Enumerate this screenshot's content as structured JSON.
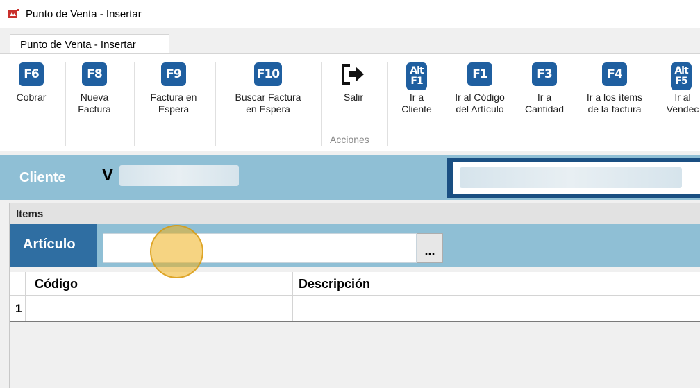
{
  "window": {
    "title": "Punto de Venta - Insertar"
  },
  "tab": {
    "label": "Punto de Venta - Insertar"
  },
  "ribbon": {
    "buttons": [
      {
        "key": "F6",
        "label": "Cobrar"
      },
      {
        "key": "F8",
        "label": "Nueva\nFactura"
      },
      {
        "key": "F9",
        "label": "Factura en\nEspera"
      },
      {
        "key": "F10",
        "label": "Buscar Factura\nen Espera"
      },
      {
        "key": "",
        "label": "Salir",
        "icon": "exit-icon"
      },
      {
        "key_top": "Alt",
        "key_bottom": "F1",
        "label": "Ir a\nCliente"
      },
      {
        "key": "F1",
        "label": "Ir al Código\ndel Artículo"
      },
      {
        "key": "F3",
        "label": "Ir a\nCantidad"
      },
      {
        "key": "F4",
        "label": "Ir a los ítems\nde la factura"
      },
      {
        "key_top": "Alt",
        "key_bottom": "F5",
        "label": "Ir al\nVendec"
      }
    ],
    "group_label": "Acciones"
  },
  "client": {
    "label": "Cliente",
    "value_initial": "V"
  },
  "items": {
    "header": "Items",
    "articulo_label": "Artículo",
    "articulo_value": "",
    "browse_button": "...",
    "columns": [
      "Código",
      "Descripción"
    ],
    "rows": [
      {
        "num": "1",
        "codigo": "",
        "descripcion": ""
      }
    ]
  },
  "colors": {
    "accent": "#1f5fa0",
    "client_bar": "#8fbfd5",
    "articulo_label_bg": "#2f6ea2",
    "cursor_highlight": "#eeb01c"
  }
}
